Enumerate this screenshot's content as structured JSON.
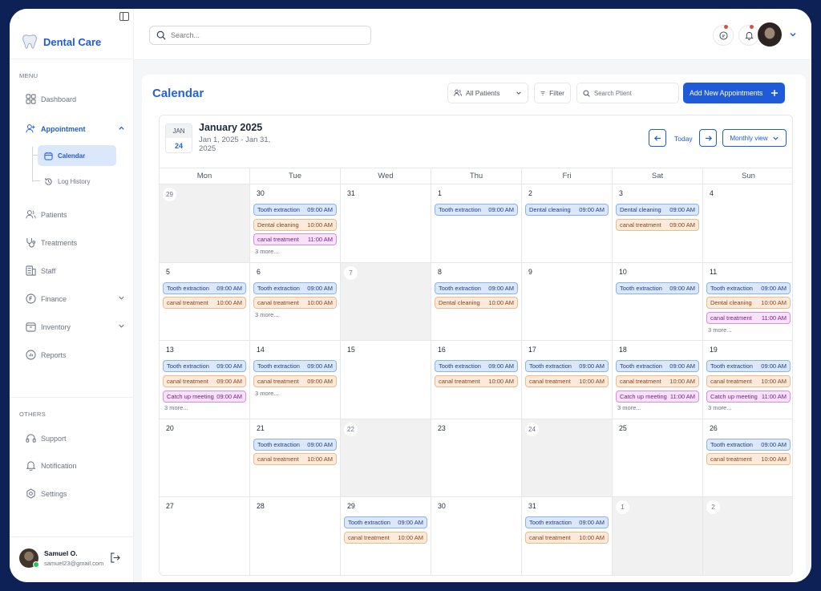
{
  "brand": {
    "name": "Dental Care"
  },
  "sidebar": {
    "menu_heading": "MENU",
    "others_heading": "OTHERS",
    "items": [
      {
        "label": "Dashboard",
        "icon": "dashboard-icon"
      },
      {
        "label": "Appointment",
        "icon": "appointment-icon"
      },
      {
        "label": "Patients",
        "icon": "patients-icon"
      },
      {
        "label": "Treatments",
        "icon": "stethoscope-icon"
      },
      {
        "label": "Staff",
        "icon": "staff-icon"
      },
      {
        "label": "Finance",
        "icon": "finance-icon"
      },
      {
        "label": "Inventory",
        "icon": "inventory-icon"
      },
      {
        "label": "Reports",
        "icon": "reports-icon"
      }
    ],
    "sub_items": [
      {
        "label": "Calendar",
        "icon": "calendar-icon"
      },
      {
        "label": "Log History",
        "icon": "history-icon"
      }
    ],
    "others": [
      {
        "label": "Support",
        "icon": "headset-icon"
      },
      {
        "label": "Notification",
        "icon": "bell-icon"
      },
      {
        "label": "Settings",
        "icon": "gear-icon"
      }
    ],
    "user": {
      "name": "Samuel O.",
      "email": "samuel23@gmail.com"
    }
  },
  "header": {
    "search_placeholder": "Search..."
  },
  "page": {
    "title": "Calendar",
    "patients_filter": "All Patients",
    "filter_label": "Filter",
    "search_patient_placeholder": "Search Ptient",
    "add_button": "Add New Appointments"
  },
  "calendar": {
    "mini_month": "JAN",
    "mini_day": "24",
    "month_title": "January 2025",
    "range": "Jan 1, 2025 - Jan 31, 2025",
    "today_label": "Today",
    "view_label": "Monthly view",
    "weekdays": [
      "Mon",
      "Tue",
      "Wed",
      "Thu",
      "Fri",
      "Sat",
      "Sun"
    ],
    "weeks": [
      [
        {
          "day": "29",
          "muted": true,
          "events": []
        },
        {
          "day": "30",
          "events": [
            {
              "title": "Tooth extraction",
              "time": "09:00 AM",
              "color": "blue"
            },
            {
              "title": "Dental cleaning",
              "time": "10:00 AM",
              "color": "orange"
            },
            {
              "title": "canal treatment",
              "time": "11:00 AM",
              "color": "purple"
            }
          ],
          "more": "3 more..."
        },
        {
          "day": "31",
          "events": []
        },
        {
          "day": "1",
          "events": [
            {
              "title": "Tooth extraction",
              "time": "09:00 AM",
              "color": "blue"
            }
          ]
        },
        {
          "day": "2",
          "events": [
            {
              "title": "Dental cleaning",
              "time": "09:00 AM",
              "color": "blue"
            }
          ]
        },
        {
          "day": "3",
          "events": [
            {
              "title": "Dental cleaning",
              "time": "09:00 AM",
              "color": "blue"
            },
            {
              "title": "canal treatment",
              "time": "09:00 AM",
              "color": "orange"
            }
          ]
        },
        {
          "day": "4",
          "events": []
        }
      ],
      [
        {
          "day": "5",
          "events": [
            {
              "title": "Tooth extraction",
              "time": "09:00 AM",
              "color": "blue"
            },
            {
              "title": "canal treatment",
              "time": "10:00 AM",
              "color": "orange"
            }
          ]
        },
        {
          "day": "6",
          "events": [
            {
              "title": "Tooth extraction",
              "time": "09:00 AM",
              "color": "blue"
            },
            {
              "title": "canal treatment",
              "time": "10:00 AM",
              "color": "orange"
            }
          ],
          "more": "3 more..."
        },
        {
          "day": "7",
          "muted": true,
          "events": []
        },
        {
          "day": "8",
          "events": [
            {
              "title": "Tooth extraction",
              "time": "09:00 AM",
              "color": "blue"
            },
            {
              "title": "Dental cleaning",
              "time": "10:00 AM",
              "color": "orange"
            }
          ]
        },
        {
          "day": "9",
          "events": []
        },
        {
          "day": "10",
          "events": [
            {
              "title": "Tooth extraction",
              "time": "09:00 AM",
              "color": "blue"
            }
          ]
        },
        {
          "day": "11",
          "events": [
            {
              "title": "Tooth extraction",
              "time": "09:00 AM",
              "color": "blue"
            },
            {
              "title": "Dental cleaning",
              "time": "10:00 AM",
              "color": "orange"
            },
            {
              "title": "canal treatment",
              "time": "11:00 AM",
              "color": "purple"
            }
          ],
          "more": "3 more..."
        }
      ],
      [
        {
          "day": "13",
          "events": [
            {
              "title": "Tooth extraction",
              "time": "09:00 AM",
              "color": "blue"
            },
            {
              "title": "canal treatment",
              "time": "09:00 AM",
              "color": "orange"
            },
            {
              "title": "Catch up meeting",
              "time": "09:00 AM",
              "color": "purple"
            }
          ],
          "more": "3 more..."
        },
        {
          "day": "14",
          "events": [
            {
              "title": "Tooth extraction",
              "time": "09:00 AM",
              "color": "blue"
            },
            {
              "title": "canal treatment",
              "time": "09:00 AM",
              "color": "orange"
            }
          ],
          "more": "3 more..."
        },
        {
          "day": "15",
          "events": []
        },
        {
          "day": "16",
          "events": [
            {
              "title": "Tooth extraction",
              "time": "09:00 AM",
              "color": "blue"
            },
            {
              "title": "canal treatment",
              "time": "10:00 AM",
              "color": "orange"
            }
          ]
        },
        {
          "day": "17",
          "events": [
            {
              "title": "Tooth extraction",
              "time": "09:00 AM",
              "color": "blue"
            },
            {
              "title": "canal treatment",
              "time": "10:00 AM",
              "color": "orange"
            }
          ]
        },
        {
          "day": "18",
          "events": [
            {
              "title": "Tooth extraction",
              "time": "09:00 AM",
              "color": "blue"
            },
            {
              "title": "canal treatment",
              "time": "10:00 AM",
              "color": "orange"
            },
            {
              "title": "Catch up meeting",
              "time": "11:00 AM",
              "color": "purple"
            }
          ],
          "more": "3 more..."
        },
        {
          "day": "19",
          "events": [
            {
              "title": "Tooth extraction",
              "time": "09:00 AM",
              "color": "blue"
            },
            {
              "title": "canal treatment",
              "time": "10:00 AM",
              "color": "orange"
            },
            {
              "title": "Catch up meeting",
              "time": "11:00 AM",
              "color": "purple"
            }
          ],
          "more": "3 more..."
        }
      ],
      [
        {
          "day": "20",
          "events": []
        },
        {
          "day": "21",
          "events": [
            {
              "title": "Tooth extraction",
              "time": "09:00 AM",
              "color": "blue"
            },
            {
              "title": "canal treatment",
              "time": "10:00 AM",
              "color": "orange"
            }
          ]
        },
        {
          "day": "22",
          "muted": true,
          "events": []
        },
        {
          "day": "23",
          "events": []
        },
        {
          "day": "24",
          "muted": true,
          "events": []
        },
        {
          "day": "25",
          "events": []
        },
        {
          "day": "26",
          "events": [
            {
              "title": "Tooth extraction",
              "time": "09:00 AM",
              "color": "blue"
            },
            {
              "title": "canal treatment",
              "time": "10:00 AM",
              "color": "orange"
            }
          ]
        }
      ],
      [
        {
          "day": "27",
          "events": []
        },
        {
          "day": "28",
          "events": []
        },
        {
          "day": "29",
          "events": [
            {
              "title": "Tooth extraction",
              "time": "09:00 AM",
              "color": "blue"
            },
            {
              "title": "canal treatment",
              "time": "10:00 AM",
              "color": "orange"
            }
          ]
        },
        {
          "day": "30",
          "events": []
        },
        {
          "day": "31",
          "events": [
            {
              "title": "Tooth extraction",
              "time": "09:00 AM",
              "color": "blue"
            },
            {
              "title": "canal treatment",
              "time": "10:00 AM",
              "color": "orange"
            }
          ]
        },
        {
          "day": "1",
          "muted": true,
          "events": []
        },
        {
          "day": "2",
          "muted": true,
          "events": []
        }
      ]
    ]
  },
  "colors": {
    "accent": "#1f5bd8",
    "frame": "#0e2156"
  }
}
